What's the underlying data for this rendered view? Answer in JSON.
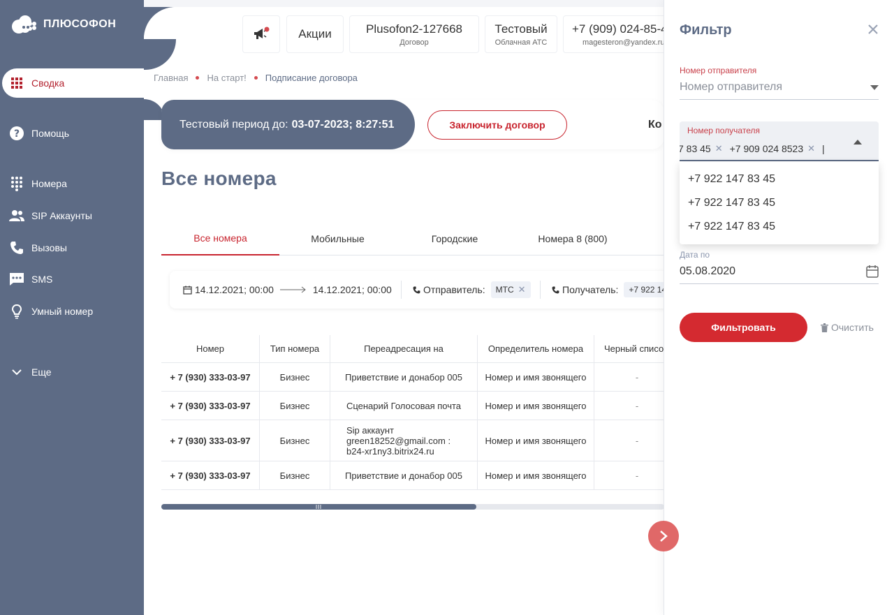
{
  "brand": {
    "name": "ПЛЮСОФОН"
  },
  "sidebar": {
    "items": [
      {
        "label": "Сводка"
      },
      {
        "label": "Помощь"
      },
      {
        "label": "Номера"
      },
      {
        "label": "SIP Аккаунты"
      },
      {
        "label": "Вызовы"
      },
      {
        "label": "SMS"
      },
      {
        "label": "Умный номер"
      },
      {
        "label": "Еще"
      }
    ]
  },
  "header": {
    "promo": "Акции",
    "contract": {
      "main": "Plusofon2-127668",
      "sub": "Договор"
    },
    "plan": {
      "main": "Тестовый",
      "sub": "Облачная АТС"
    },
    "account": {
      "main": "+7 (909) 024-85-4",
      "sub": "magesteron@yandex.ru"
    }
  },
  "breadcrumbs": [
    "Главная",
    "На старт!",
    "Подписание договора"
  ],
  "trial": {
    "label": "Тестовый период до:",
    "date": "03-07-2023; 8:27:51",
    "contract_button": "Заключить договор",
    "cut_text": "Ко"
  },
  "page_title": "Все номера",
  "tabs": [
    "Все номера",
    "Мобильные",
    "Городские",
    "Номера 8 (800)"
  ],
  "filter_strip": {
    "date_from": "14.12.2021; 00:00",
    "date_to": "14.12.2021; 00:00",
    "sender_label": "Отправитель:",
    "sender_chip": "МТС",
    "recipient_label": "Получатель:",
    "recipient_chip": "+7 922 14"
  },
  "table": {
    "columns": [
      "Номер",
      "Тип номера",
      "Переадресация на",
      "Определитель номера",
      "Черный списо"
    ],
    "rows": [
      {
        "number": "+ 7 (930) 333-03-97",
        "type": "Бизнес",
        "forward": "Приветствие и донабор 005",
        "caller_id": "Номер и имя звонящего",
        "blacklist": "-"
      },
      {
        "number": "+ 7 (930) 333-03-97",
        "type": "Бизнес",
        "forward": "Сценарий Голосовая почта",
        "caller_id": "Номер и имя звонящего",
        "blacklist": "-"
      },
      {
        "number": "+ 7 (930) 333-03-97",
        "type": "Бизнес",
        "forward": "Sip аккаунт green18252@gmail.com : b24-xr1ny3.bitrix24.ru",
        "caller_id": "Номер и имя звонящего",
        "blacklist": "-"
      },
      {
        "number": "+ 7 (930) 333-03-97",
        "type": "Бизнес",
        "forward": "Приветствие и донабор 005",
        "caller_id": "Номер и имя звонящего",
        "blacklist": "-"
      }
    ]
  },
  "filter_panel": {
    "title": "Фильтр",
    "sender": {
      "label": "Номер отправителя",
      "placeholder": "Номер отправителя"
    },
    "recipient": {
      "label": "Номер получателя",
      "chips": [
        "7 83 45",
        "+7 909 024 8523"
      ],
      "options": [
        "+7 922 147 83 45",
        "+7 922 147 83 45",
        "+7 922 147 83 45"
      ]
    },
    "date_to": {
      "label": "Дата по",
      "value": "05.08.2020"
    },
    "filter_button": "Фильтровать",
    "clear_button": "Очистить"
  },
  "colors": {
    "sidebar_bg": "#5d6b85",
    "accent_red": "#c8242e",
    "expand_button": "#e06868"
  }
}
